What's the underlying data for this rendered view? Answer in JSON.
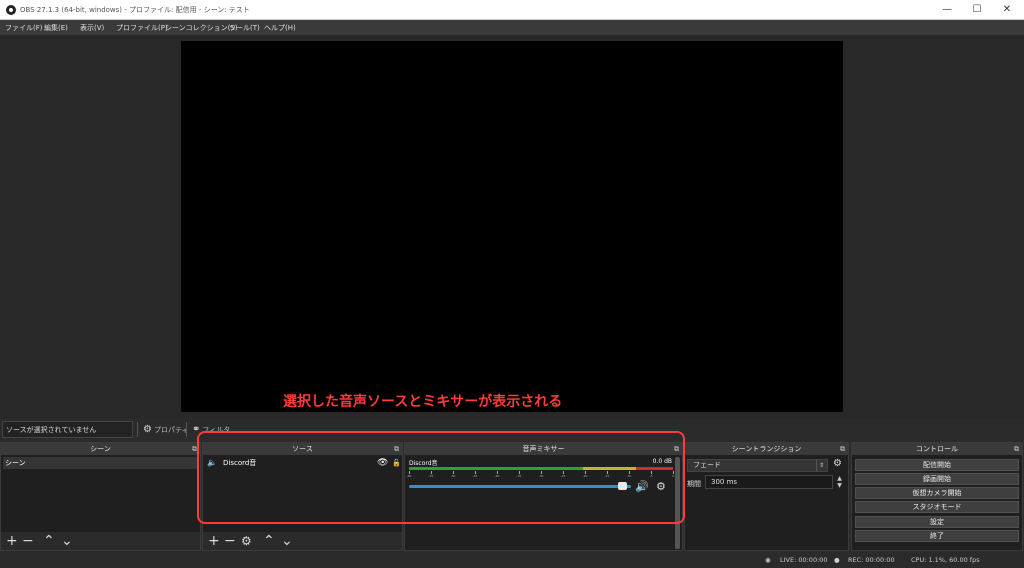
{
  "window": {
    "title": "OBS 27.1.3 (64-bit, windows) - プロファイル: 配信用 - シーン: テスト",
    "minimize": "—",
    "maximize": "☐",
    "close": "✕"
  },
  "menu": [
    "ファイル(F)",
    "編集(E)",
    "表示(V)",
    "プロファイル(P)",
    "シーンコレクション(S)",
    "ツール(T)",
    "ヘルプ(H)"
  ],
  "annotation": "選択した音声ソースとミキサーが表示される",
  "source_toolbar": {
    "no_source": "ソースが選択されていません",
    "properties": "プロパティ",
    "filters": "フィルタ"
  },
  "docks": {
    "scenes": {
      "title": "シーン",
      "items": [
        "シーン"
      ]
    },
    "sources": {
      "title": "ソース",
      "items": [
        {
          "name": "Discord音"
        }
      ]
    },
    "mixer": {
      "title": "音声ミキサー",
      "channel": {
        "name": "Discord音",
        "db": "0.0 dB",
        "volume_fraction": 0.96
      },
      "scale": [
        "-60",
        "-55",
        "-50",
        "-45",
        "-40",
        "-35",
        "-30",
        "-25",
        "-20",
        "-15",
        "-10",
        "-5",
        "0"
      ]
    },
    "transitions": {
      "title": "シーントランジション",
      "selected": "フェード",
      "duration_label": "期間",
      "duration_value": "300 ms"
    },
    "controls": {
      "title": "コントロール",
      "buttons": [
        "配信開始",
        "録画開始",
        "仮想カメラ開始",
        "スタジオモード",
        "設定",
        "終了"
      ]
    }
  },
  "status": {
    "live": "LIVE: 00:00:00",
    "rec": "REC: 00:00:00",
    "cpu": "CPU: 1.1%, 60.00 fps"
  },
  "colors": {
    "highlight": "#ff3b3b",
    "meter_green": "#2fa12f",
    "meter_yellow": "#c8b22c",
    "meter_red": "#c8322c",
    "volume_blue": "#2d8fd8"
  }
}
